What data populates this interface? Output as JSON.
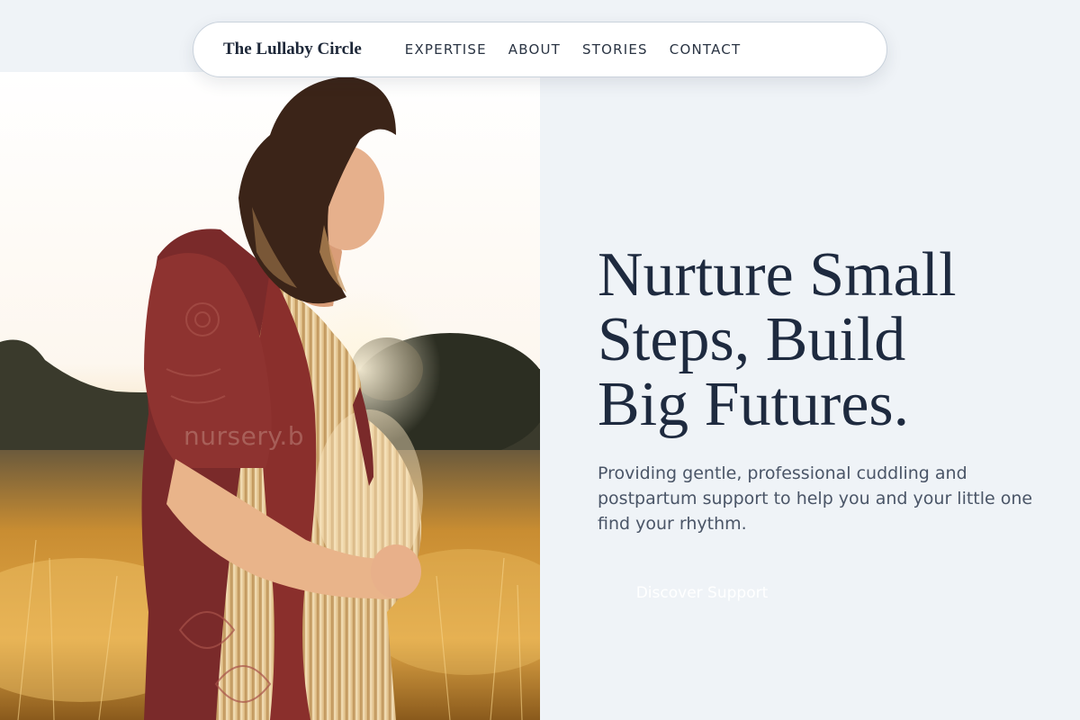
{
  "nav": {
    "brand": "The Lullaby Circle",
    "links": [
      "EXPERTISE",
      "ABOUT",
      "STORIES",
      "CONTACT"
    ]
  },
  "hero": {
    "headline_lines": [
      "Nurture Small",
      "Steps, Build",
      "Big Futures."
    ],
    "subtext": "Providing gentle, professional cuddling and postpartum support to help you and your little one find your rhythm.",
    "cta_label": "Discover Support",
    "watermark": "nursery.b"
  },
  "colors": {
    "page_bg": "#eff3f7",
    "headline": "#1e2a3f",
    "body_text": "#4a5567",
    "cardigan": "#7a2a2a",
    "field_gold": "#d9a243"
  }
}
